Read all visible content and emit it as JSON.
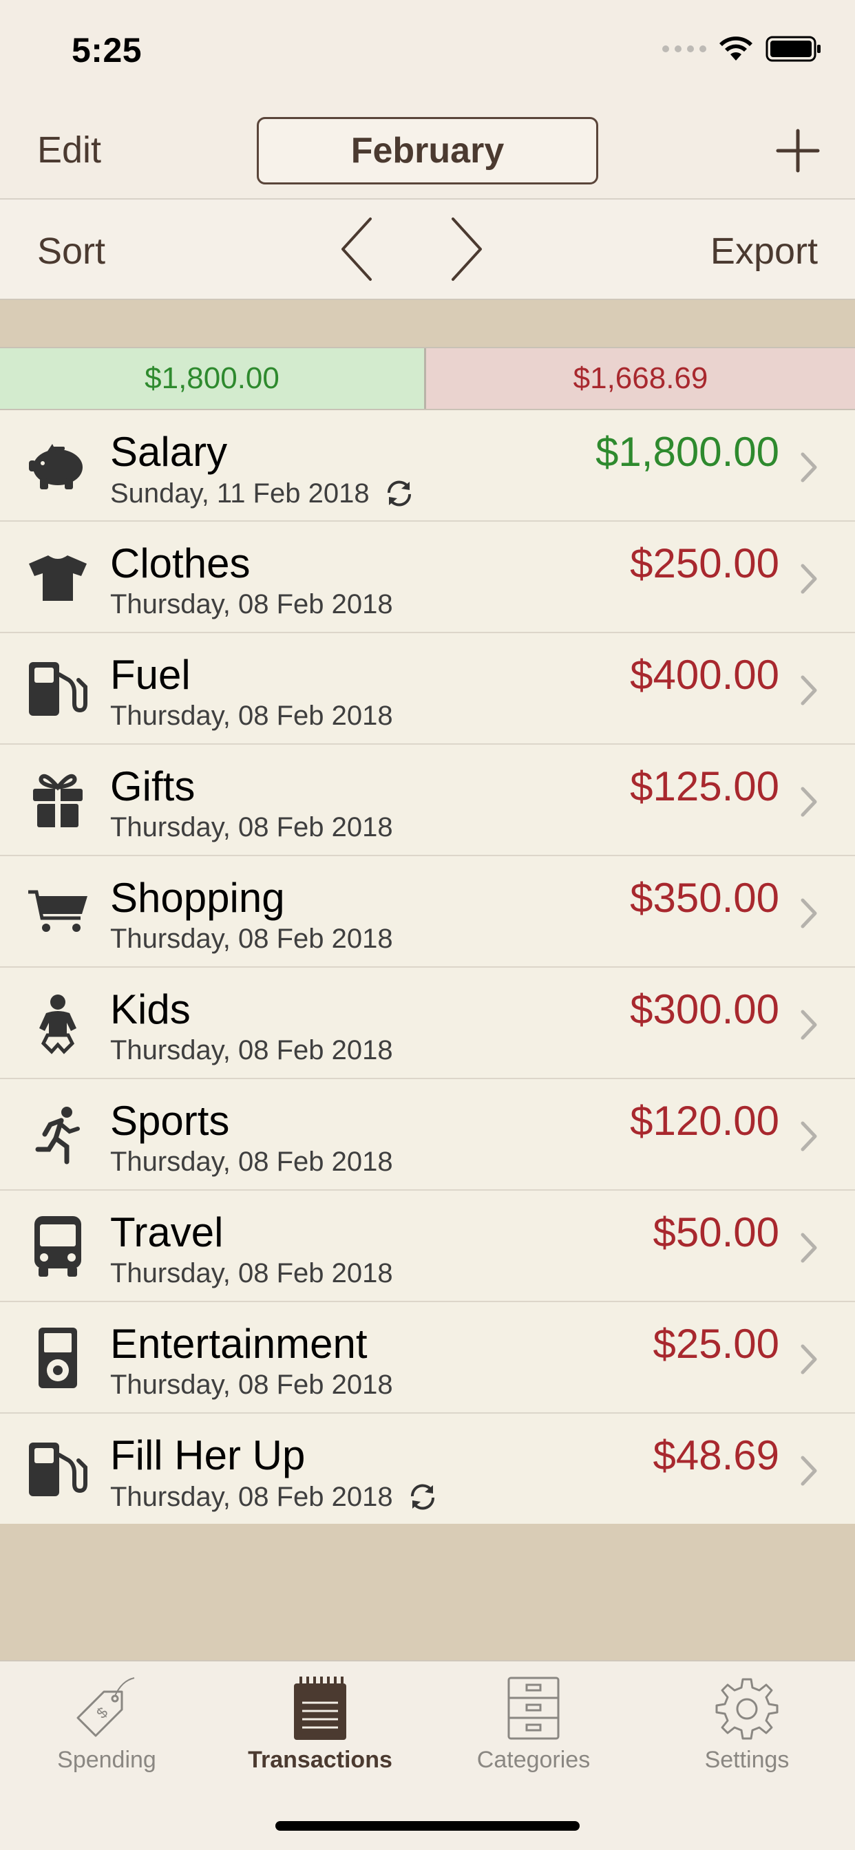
{
  "status_bar": {
    "time": "5:25"
  },
  "nav": {
    "edit_label": "Edit",
    "month_label": "February",
    "add_icon": "plus-icon"
  },
  "toolbar": {
    "sort_label": "Sort",
    "export_label": "Export",
    "prev_icon": "chevron-left-icon",
    "next_icon": "chevron-right-icon"
  },
  "totals": {
    "income": "$1,800.00",
    "expense": "$1,668.69"
  },
  "colors": {
    "income": "#2e8a2e",
    "expense": "#a8282e",
    "accent": "#4b3a30"
  },
  "transactions": [
    {
      "title": "Salary",
      "date": "Sunday, 11 Feb 2018",
      "amount": "$1,800.00",
      "type": "income",
      "icon": "piggy-bank-icon",
      "recurring": true
    },
    {
      "title": "Clothes",
      "date": "Thursday, 08 Feb 2018",
      "amount": "$250.00",
      "type": "expense",
      "icon": "tshirt-icon",
      "recurring": false
    },
    {
      "title": "Fuel",
      "date": "Thursday, 08 Feb 2018",
      "amount": "$400.00",
      "type": "expense",
      "icon": "fuel-pump-icon",
      "recurring": false
    },
    {
      "title": "Gifts",
      "date": "Thursday, 08 Feb 2018",
      "amount": "$125.00",
      "type": "expense",
      "icon": "gift-icon",
      "recurring": false
    },
    {
      "title": "Shopping",
      "date": "Thursday, 08 Feb 2018",
      "amount": "$350.00",
      "type": "expense",
      "icon": "shopping-cart-icon",
      "recurring": false
    },
    {
      "title": "Kids",
      "date": "Thursday, 08 Feb 2018",
      "amount": "$300.00",
      "type": "expense",
      "icon": "baby-icon",
      "recurring": false
    },
    {
      "title": "Sports",
      "date": "Thursday, 08 Feb 2018",
      "amount": "$120.00",
      "type": "expense",
      "icon": "running-icon",
      "recurring": false
    },
    {
      "title": "Travel",
      "date": "Thursday, 08 Feb 2018",
      "amount": "$50.00",
      "type": "expense",
      "icon": "bus-icon",
      "recurring": false
    },
    {
      "title": "Entertainment",
      "date": "Thursday, 08 Feb 2018",
      "amount": "$25.00",
      "type": "expense",
      "icon": "music-player-icon",
      "recurring": false
    },
    {
      "title": "Fill Her Up",
      "date": "Thursday, 08 Feb 2018",
      "amount": "$48.69",
      "type": "expense",
      "icon": "fuel-pump-icon",
      "recurring": true
    }
  ],
  "tabs": [
    {
      "label": "Spending",
      "icon": "price-tag-icon",
      "active": false
    },
    {
      "label": "Transactions",
      "icon": "notepad-icon",
      "active": true
    },
    {
      "label": "Categories",
      "icon": "drawers-icon",
      "active": false
    },
    {
      "label": "Settings",
      "icon": "gear-icon",
      "active": false
    }
  ]
}
